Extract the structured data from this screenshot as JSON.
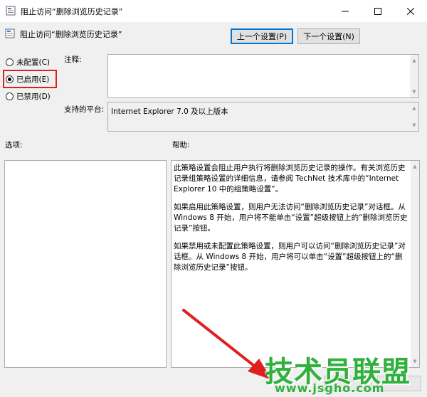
{
  "window": {
    "title": "阻止访问“删除浏览历史记录”"
  },
  "header": {
    "policy_title": "阻止访问“删除浏览历史记录”",
    "prev_button": "上一个设置(P)",
    "next_button": "下一个设置(N)"
  },
  "state": {
    "options": [
      {
        "label": "未配置(C)",
        "checked": false
      },
      {
        "label": "已启用(E)",
        "checked": true
      },
      {
        "label": "已禁用(D)",
        "checked": false
      }
    ]
  },
  "fields": {
    "comment_label": "注释:",
    "comment_value": "",
    "platform_label": "支持的平台:",
    "platform_value": "Internet Explorer 7.0 及以上版本"
  },
  "sections": {
    "options_label": "选项:",
    "help_label": "帮助:"
  },
  "help": {
    "paragraphs": [
      "此策略设置会阻止用户执行将删除浏览历史记录的操作。有关浏览历史记录组策略设置的详细信息，请参阅 TechNet 技术库中的“Internet Explorer 10 中的组策略设置”。",
      "如果启用此策略设置，则用户无法访问“删除浏览历史记录”对话框。从 Windows 8 开始，用户将不能单击“设置”超级按钮上的“删除浏览历史记录”按钮。",
      "如果禁用或未配置此策略设置，则用户可以访问“删除浏览历史记录”对话框。从 Windows 8 开始，用户将可以单击“设置”超级按钮上的“删除浏览历史记录”按钮。"
    ]
  },
  "watermark": {
    "brand": "技术员联盟",
    "url": "www.jsgho.com"
  },
  "colors": {
    "highlight": "#e02020",
    "arrow": "#e02020",
    "watermark": "#2fb13b",
    "focus_border": "#0078d7"
  }
}
